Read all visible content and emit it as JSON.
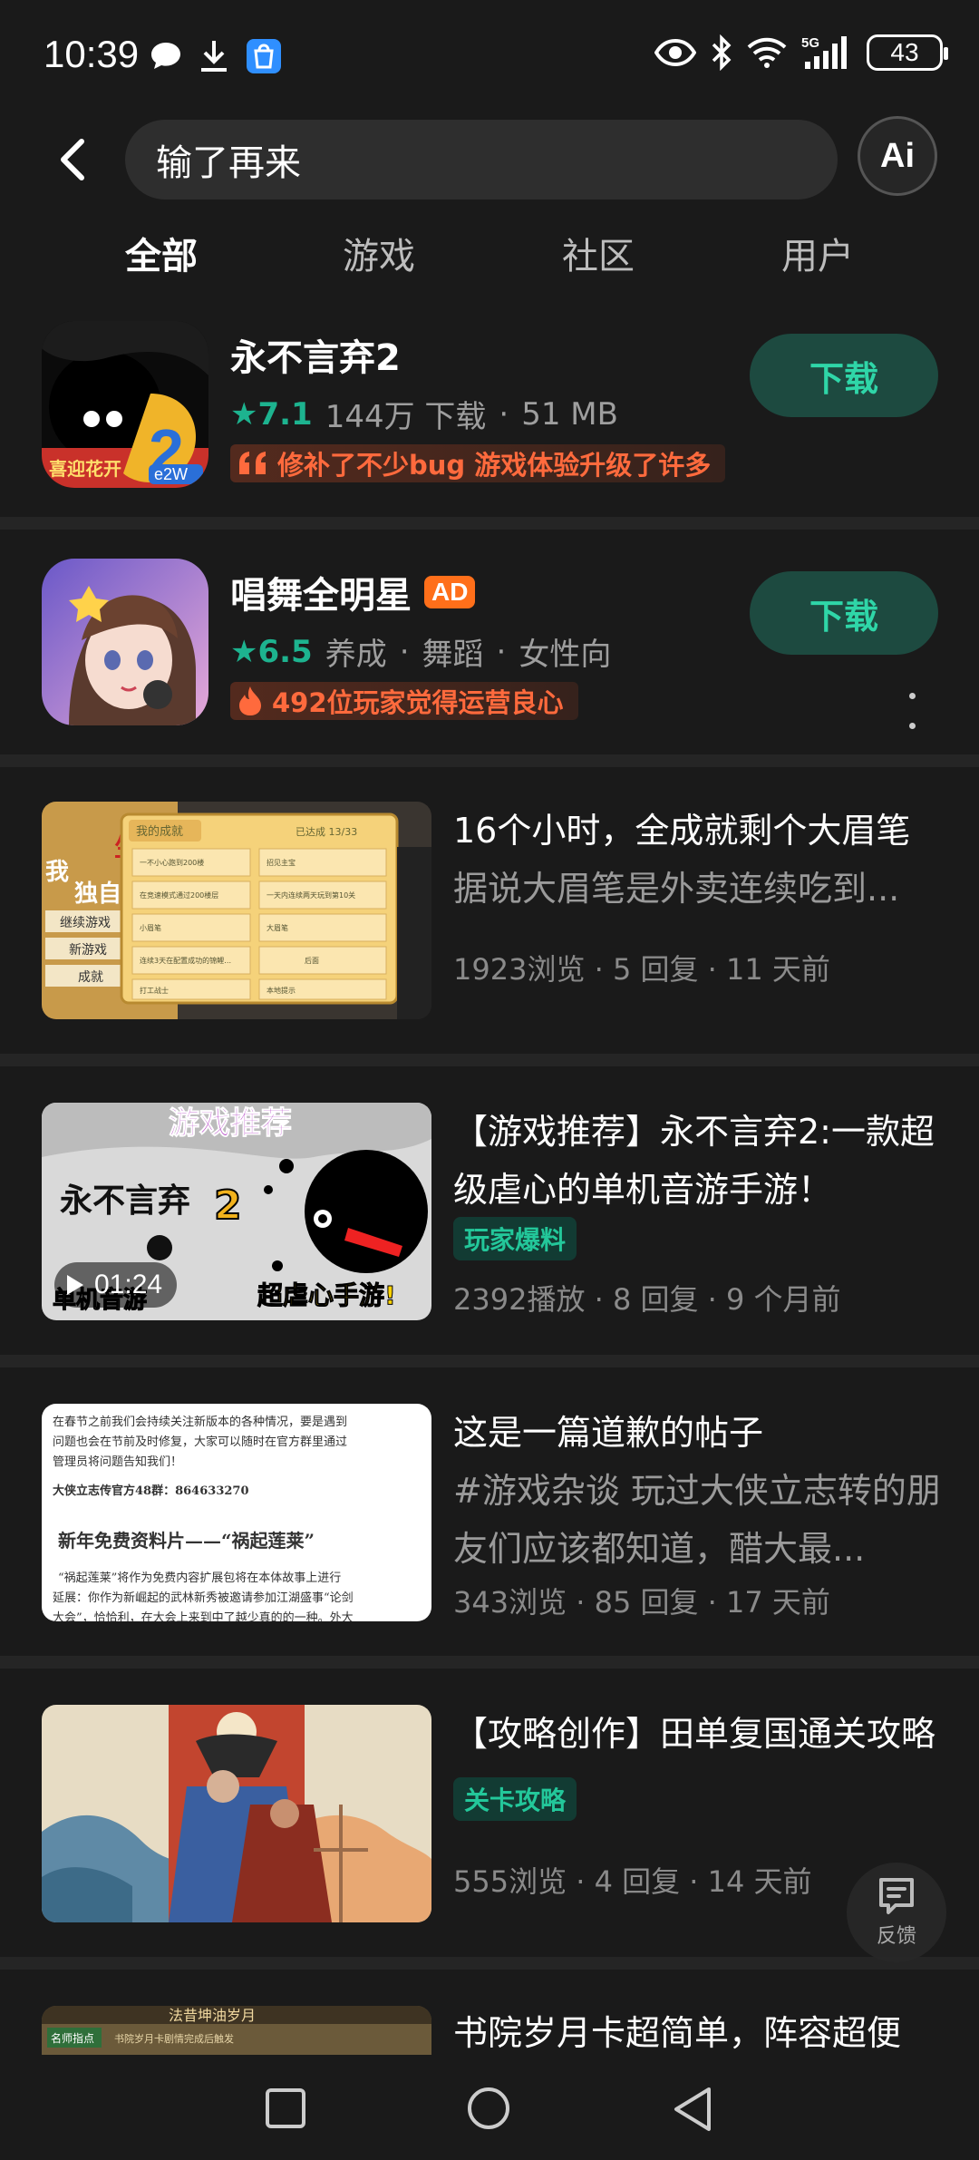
{
  "status_bar": {
    "time": "10:39",
    "battery": "43",
    "network": "5G"
  },
  "search": {
    "query": "输了再来",
    "ai_label": "Ai"
  },
  "tabs": [
    {
      "label": "全部",
      "active": true
    },
    {
      "label": "游戏",
      "active": false
    },
    {
      "label": "社区",
      "active": false
    },
    {
      "label": "用户",
      "active": false
    }
  ],
  "games": [
    {
      "title": "永不言弃2",
      "rating": "7.1",
      "meta1": "144万 下载",
      "meta2": "51 MB",
      "tag": "修补了不少bug 游戏体验升级了许多",
      "button": "下载"
    },
    {
      "title": "唱舞全明星",
      "ad": "AD",
      "rating": "6.5",
      "meta1": "养成",
      "meta2": "舞蹈",
      "meta3": "女性向",
      "tag": "492位玩家觉得运营良心",
      "button": "下载"
    }
  ],
  "posts": [
    {
      "title": "16个小时，全成就剩个大眉笔",
      "subtitle": "据说大眉笔是外卖连续吃到...",
      "meta": "1923浏览 · 5 回复 · 11 天前",
      "thumb": {
        "left_words": [
          "我",
          "生",
          "独自"
        ],
        "menu": [
          "继续游戏",
          "新游戏",
          "成就"
        ],
        "panel_title": "我的成就",
        "panel_count": "已达成 13/33",
        "cells": [
          "一不小心跑到200楼",
          "招见主宝",
          "在竞速模式通过200楼层",
          "一天内连续两天玩到第10关",
          "小眉笔",
          "大眉笔",
          "连续3天在配置成功的锦鲤…",
          "后面",
          "打工战士",
          "本地提示"
        ]
      }
    },
    {
      "title": "【游戏推荐】永不言弃2:一款超级虐心的单机音游手游！",
      "tag": "玩家爆料",
      "meta": "2392播放 · 8 回复 · 9 个月前",
      "duration": "01:24",
      "thumb": {
        "top": "游戏推荐",
        "name": "永不言弃",
        "bottom_left": "单机音游",
        "bottom_right": "超虐心手游!"
      }
    },
    {
      "title": "这是一篇道歉的帖子",
      "subtitle": "#游戏杂谈 玩过大侠立志转的朋友们应该都知道，醋大最...",
      "meta": "343浏览 · 85 回复 · 17 天前",
      "thumb": {
        "l1": "在春节之前我们会持续关注新版本的各种情况，要是遇到",
        "l2": "问题也会在节前及时修复，大家可以随时在官方群里通过",
        "l3": "管理员将问题告知我们！",
        "l4": "大侠立志传官方48群：864633270",
        "l5": "新年免费资料片——“祸起莲莱”",
        "l6": "“祸起莲莱”将作为免费内容扩展包将在本体故事上进行",
        "l7": "延展：你作为新崛起的武林新秀被邀请参加江湖盛事“论剑",
        "l8": "大会”，恰恰利，在大会上来到中了越少真的的一种。外大"
      }
    },
    {
      "title": "【攻略创作】田单复国通关攻略",
      "tag": "关卡攻略",
      "meta": "555浏览 · 4 回复 · 14 天前"
    },
    {
      "title": "书院岁月卡超简单，阵容超便",
      "thumb": {
        "banner": "法昔坤油岁月",
        "cap": "名师指点",
        "desc": "书院岁月卡剧情完成后触发"
      }
    }
  ],
  "feedback_label": "反馈",
  "colors": {
    "accent": "#1db38f",
    "background": "#1a1a1a",
    "tag_orange": "#ff6a3d"
  }
}
